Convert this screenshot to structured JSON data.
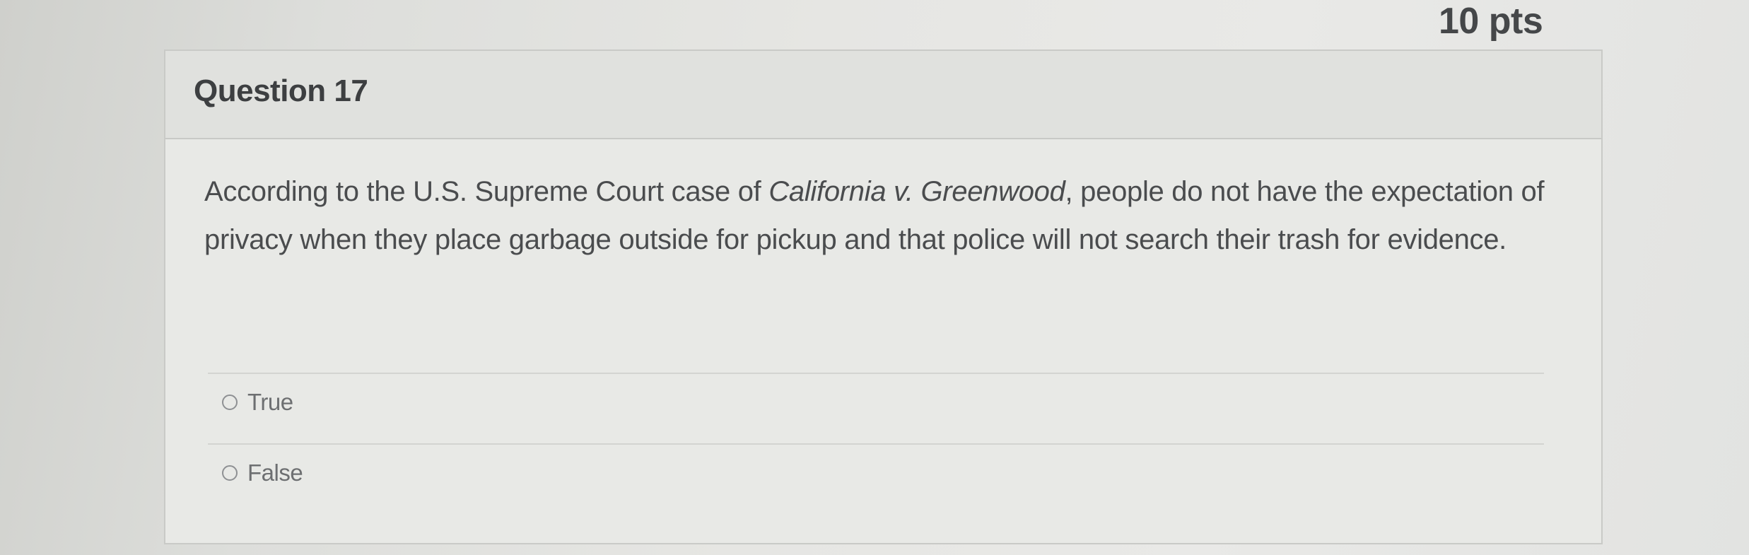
{
  "question": {
    "title": "Question 17",
    "points": "10 pts",
    "text_before": "According to the U.S. Supreme Court case of ",
    "case_name": "California v. Greenwood",
    "text_after": ", people do not have the expectation of privacy when they place garbage outside for pickup and that police will not search their trash for evidence."
  },
  "answers": [
    {
      "label": "True"
    },
    {
      "label": "False"
    }
  ]
}
